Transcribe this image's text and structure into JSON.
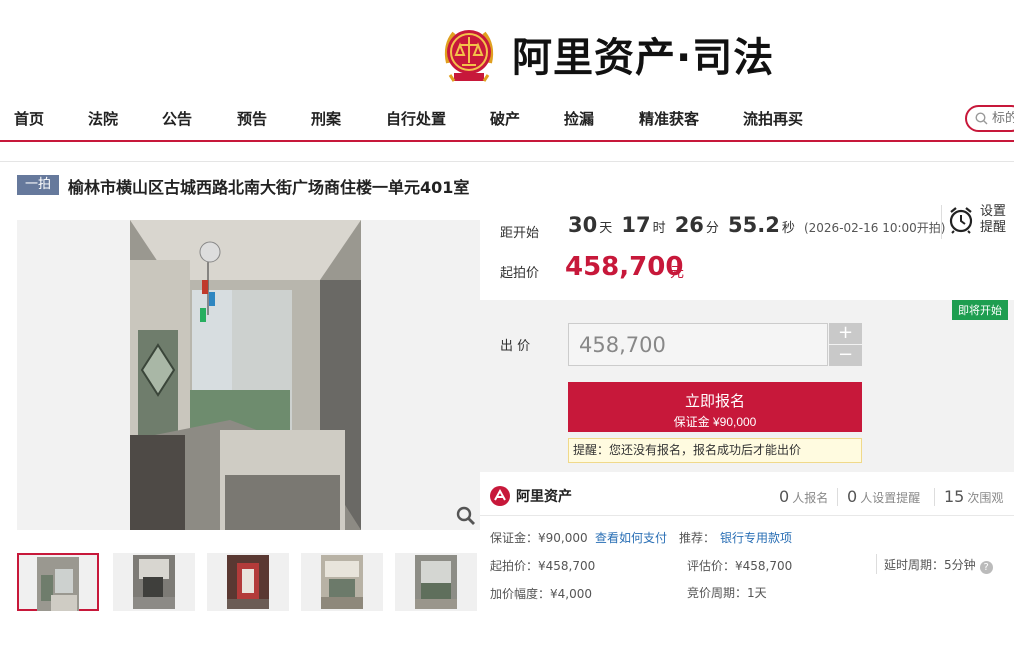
{
  "header": {
    "logo_text": "阿里资产·司法"
  },
  "nav": {
    "items": [
      "首页",
      "法院",
      "公告",
      "预告",
      "刑案",
      "自行处置",
      "破产",
      "捡漏",
      "精准获客",
      "流拍再买"
    ],
    "search_placeholder": "标的"
  },
  "listing": {
    "tag": "一拍",
    "title": "榆林市横山区古城西路北南大街广场商住楼一单元401室"
  },
  "countdown": {
    "label": "距开始",
    "days": "30",
    "days_unit": "天",
    "hours": "17",
    "hours_unit": "时",
    "minutes": "26",
    "minutes_unit": "分",
    "seconds": "55.2",
    "seconds_unit": "秒",
    "start_note": "(2026-02-16 10:00开拍)"
  },
  "remind": {
    "line1": "设置",
    "line2": "提醒"
  },
  "start_price": {
    "label": "起拍价",
    "value": "458,700",
    "unit": "元"
  },
  "bid": {
    "badge": "即将开始",
    "label": "出 价",
    "input_value": "458,700",
    "plus": "+",
    "minus": "−",
    "register_label": "立即报名",
    "deposit_line": "保证金 ¥90,000",
    "hint": "提醒：您还没有报名，报名成功后才能出价"
  },
  "stats": {
    "brand": "阿里资产",
    "registered_count": "0",
    "registered_label": "人报名",
    "reminder_count": "0",
    "reminder_label": "人设置提醒",
    "views_count": "15",
    "views_label": "次围观"
  },
  "details": {
    "deposit": "保证金：¥90,000",
    "how_to_pay": "查看如何支付",
    "recommend_label": "推荐：",
    "bank_loan": "银行专用款项",
    "start_price": "起拍价：¥458,700",
    "appraisal": "评估价：¥458,700",
    "delay_period": "延时周期：5分钟",
    "increment": "加价幅度：¥4,000",
    "bid_period": "竞价周期：1天"
  },
  "colors": {
    "accent": "#c7183a",
    "badge": "#1e9e50",
    "link": "#2a6fb5"
  }
}
